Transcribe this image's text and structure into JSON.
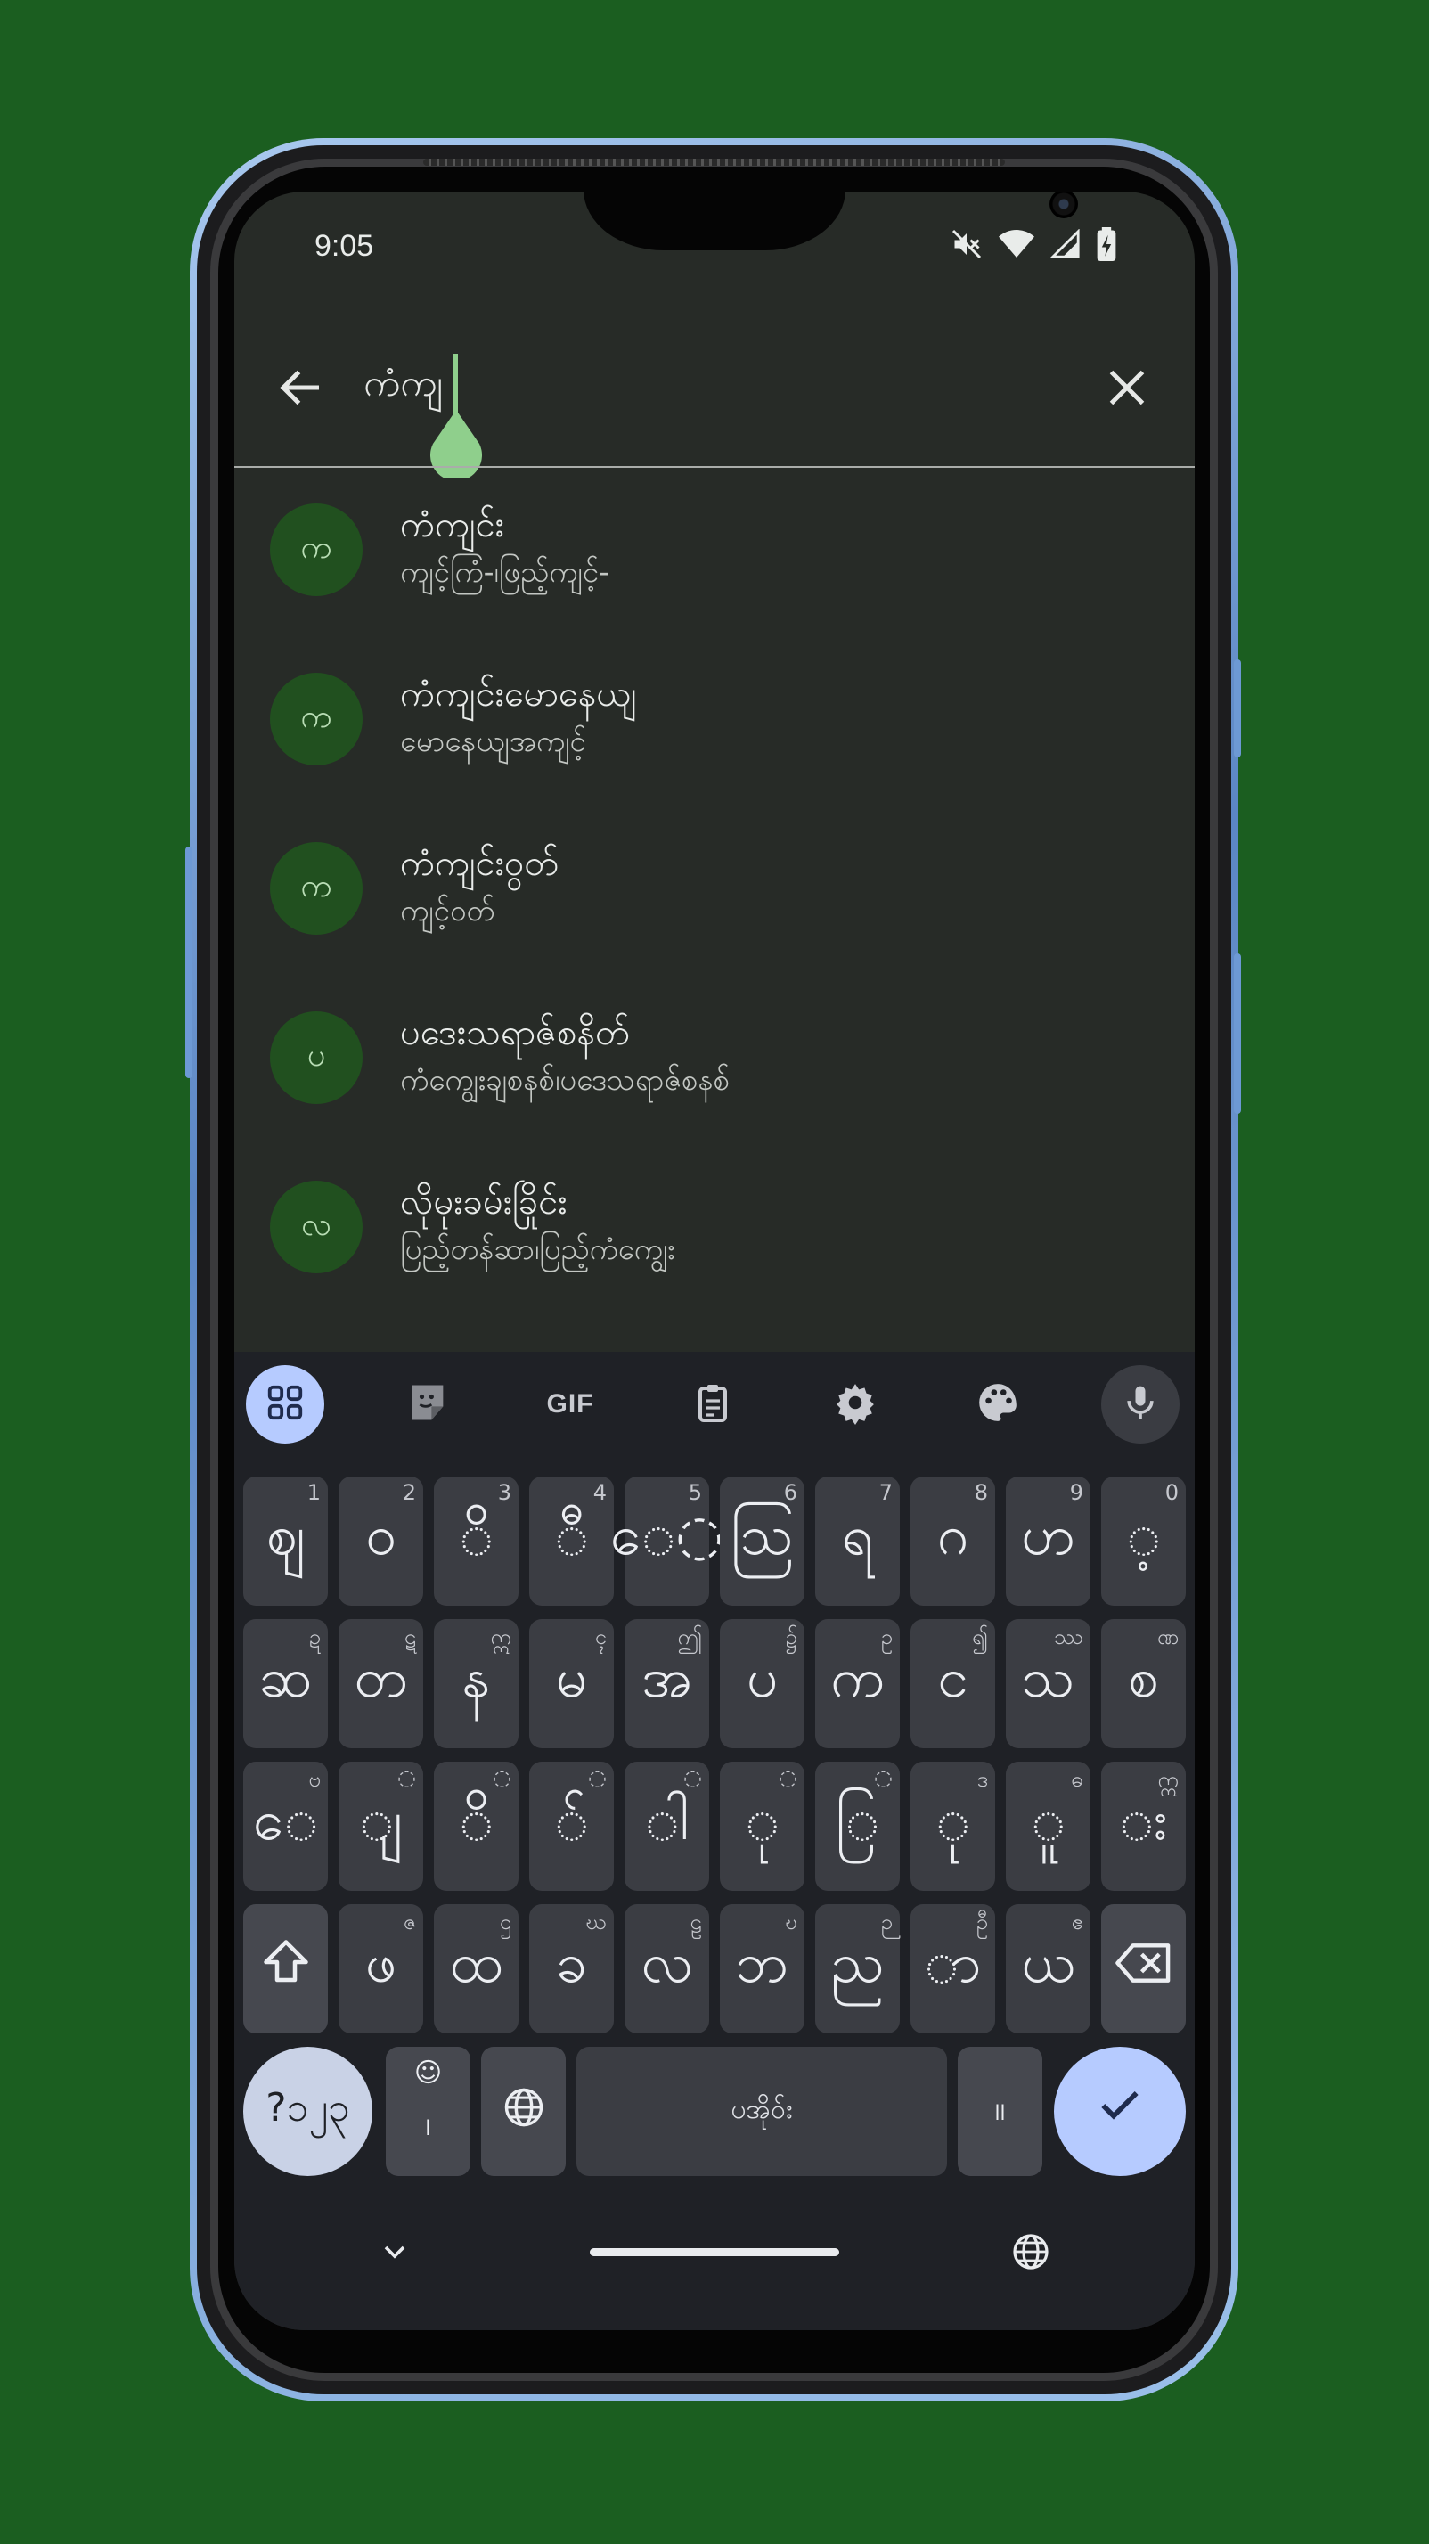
{
  "status_bar": {
    "time": "9:05"
  },
  "search": {
    "query": "ကံကျ"
  },
  "suggestions": [
    {
      "avatar": "က",
      "title": "ကံကျင်း",
      "subtitle": "ကျင့်ကြံ-၊ဖြည့်ကျင့်-"
    },
    {
      "avatar": "က",
      "title": "ကံကျင်းမောနေယျ",
      "subtitle": "မောနေယျအကျင့်"
    },
    {
      "avatar": "က",
      "title": "ကံကျင်းဝွတ်",
      "subtitle": "ကျင့်ဝတ်"
    },
    {
      "avatar": "ပ",
      "title": "ပဒေးသရာဇ်စနိတ်",
      "subtitle": "ကံကျွေးချစနစ်၊ပဒေသရာဇ်စနစ်"
    },
    {
      "avatar": "လ",
      "title": "လိုမုးခမ်းခြိုင်း",
      "subtitle": "ပြည့်တန်ဆာ၊ပြည့်ကံကျွေး"
    }
  ],
  "keyboard": {
    "toolbar": {
      "gif_label": "GIF"
    },
    "rows": [
      [
        {
          "k": "ဈ",
          "h": "1"
        },
        {
          "k": "ဝ",
          "h": "2"
        },
        {
          "k": "◌ိ",
          "h": "3"
        },
        {
          "k": "◌ီ",
          "h": "4"
        },
        {
          "k": "ေ◌",
          "h": "5"
        },
        {
          "k": "ဩ",
          "h": "6"
        },
        {
          "k": "ရ",
          "h": "7"
        },
        {
          "k": "ဂ",
          "h": "8"
        },
        {
          "k": "ဟ",
          "h": "9"
        },
        {
          "k": "◌့",
          "h": "0"
        }
      ],
      [
        {
          "k": "ဆ",
          "h": "ဍ"
        },
        {
          "k": "တ",
          "h": "ဋ"
        },
        {
          "k": "န",
          "h": "ဣ"
        },
        {
          "k": "မ",
          "h": "ၚ"
        },
        {
          "k": "အ",
          "h": "ဤ"
        },
        {
          "k": "ပ",
          "h": "၌"
        },
        {
          "k": "က",
          "h": "ဥ"
        },
        {
          "k": "င",
          "h": "၍"
        },
        {
          "k": "သ",
          "h": "ဿ"
        },
        {
          "k": "စ",
          "h": "ဏ"
        }
      ],
      [
        {
          "k": "ေ",
          "h": "ဗ"
        },
        {
          "k": "ျ",
          "h": "◌"
        },
        {
          "k": "ိ",
          "h": "◌"
        },
        {
          "k": "်",
          "h": "◌"
        },
        {
          "k": "ါ",
          "h": "◌"
        },
        {
          "k": "ု",
          "h": "◌"
        },
        {
          "k": "ြ",
          "h": "◌"
        },
        {
          "k": "ု",
          "h": "ဒ"
        },
        {
          "k": "ူ",
          "h": "ဓ"
        },
        {
          "k": "း",
          "h": "ဣ"
        }
      ],
      [
        {
          "k": "ဖ",
          "h": "ဇ"
        },
        {
          "k": "ထ",
          "h": "ဌ"
        },
        {
          "k": "ခ",
          "h": "ဃ"
        },
        {
          "k": "လ",
          "h": "ဠ"
        },
        {
          "k": "ဘ",
          "h": "ဎ"
        },
        {
          "k": "ည",
          "h": "ဉ"
        },
        {
          "k": "ာ",
          "h": "ဦ"
        },
        {
          "k": "ယ",
          "h": "ဧ"
        }
      ]
    ],
    "bottom": {
      "symbols_label": "?၁၂၃",
      "emoji_comma_label": "၊",
      "space_label": "ပအိုဝ်း",
      "period_label": "။"
    }
  }
}
